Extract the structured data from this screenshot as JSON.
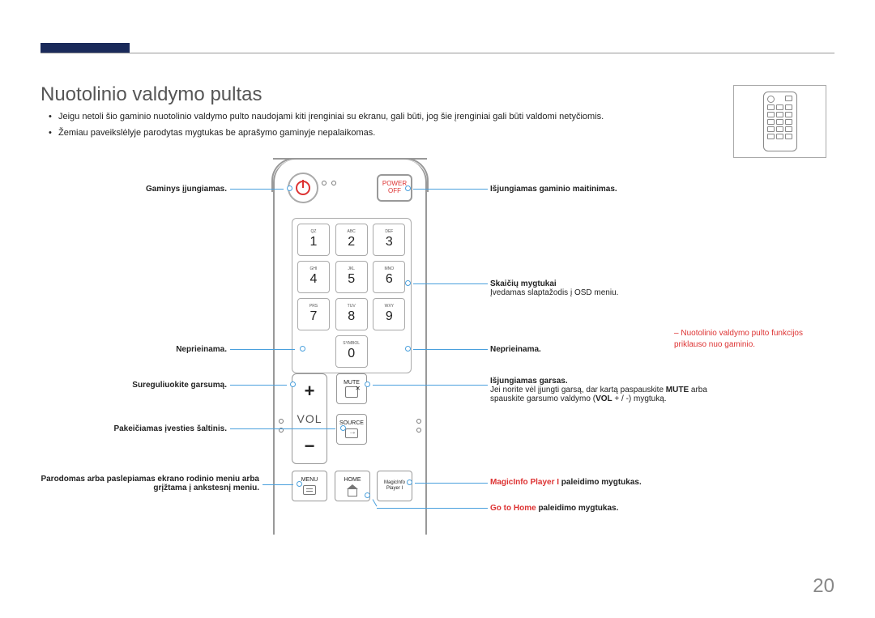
{
  "page": {
    "number": "20"
  },
  "title": "Nuotolinio valdymo pultas",
  "bullets": [
    "Jeigu netoli šio gaminio nuotolinio valdymo pulto naudojami kiti įrenginiai su ekranu, gali būti, jog šie įrenginiai gali būti valdomi netyčiomis.",
    "Žemiau paveikslėlyje parodytas mygtukas be aprašymo gaminyje nepalaikomas."
  ],
  "remote": {
    "power_off": {
      "l1": "POWER",
      "l2": "OFF"
    },
    "keys": [
      {
        "sub": "QZ",
        "main": "1"
      },
      {
        "sub": "ABC",
        "main": "2"
      },
      {
        "sub": "DEF",
        "main": "3"
      },
      {
        "sub": "GHI",
        "main": "4"
      },
      {
        "sub": "JKL",
        "main": "5"
      },
      {
        "sub": "MNO",
        "main": "6"
      },
      {
        "sub": "PRS",
        "main": "7"
      },
      {
        "sub": "TUV",
        "main": "8"
      },
      {
        "sub": "WXY",
        "main": "9"
      },
      {
        "sub": "SYMBOL",
        "main": "0"
      }
    ],
    "vol": "VOL",
    "mute": "MUTE",
    "source": "SOURCE",
    "menu": "MENU",
    "home": "HOME",
    "magicinfo": {
      "l1": "MagicInfo",
      "l2": "Player I"
    }
  },
  "ann": {
    "power_on": "Gaminys įjungiamas.",
    "power_off": "Išjungiamas gaminio maitinimas.",
    "num1": "Skaičių mygtukai",
    "num2": "Įvedamas slaptažodis į OSD meniu.",
    "na_l": "Neprieinama.",
    "na_r": "Neprieinama.",
    "vol": "Sureguliuokite garsumą.",
    "src": "Pakeičiamas įvesties šaltinis.",
    "menu": "Parodomas arba paslepiamas ekrano rodinio meniu arba grįžtama į ankstesnį meniu.",
    "mute1": "Išjungiamas garsas.",
    "mute2": "Jei norite vėl įjungti garsą, dar kartą paspauskite ",
    "mute3": "MUTE",
    "mute4": " arba spauskite garsumo valdymo (",
    "mute5": "VOL",
    "mute6": " + / -) mygtuką.",
    "mip1": "MagicInfo Player I",
    "mip2": " paleidimo mygtukas.",
    "home1": "Go to Home",
    "home2": " paleidimo mygtukas."
  },
  "footnote": {
    "dash": "–",
    "text": "Nuotolinio valdymo pulto funkcijos priklauso nuo gaminio."
  }
}
